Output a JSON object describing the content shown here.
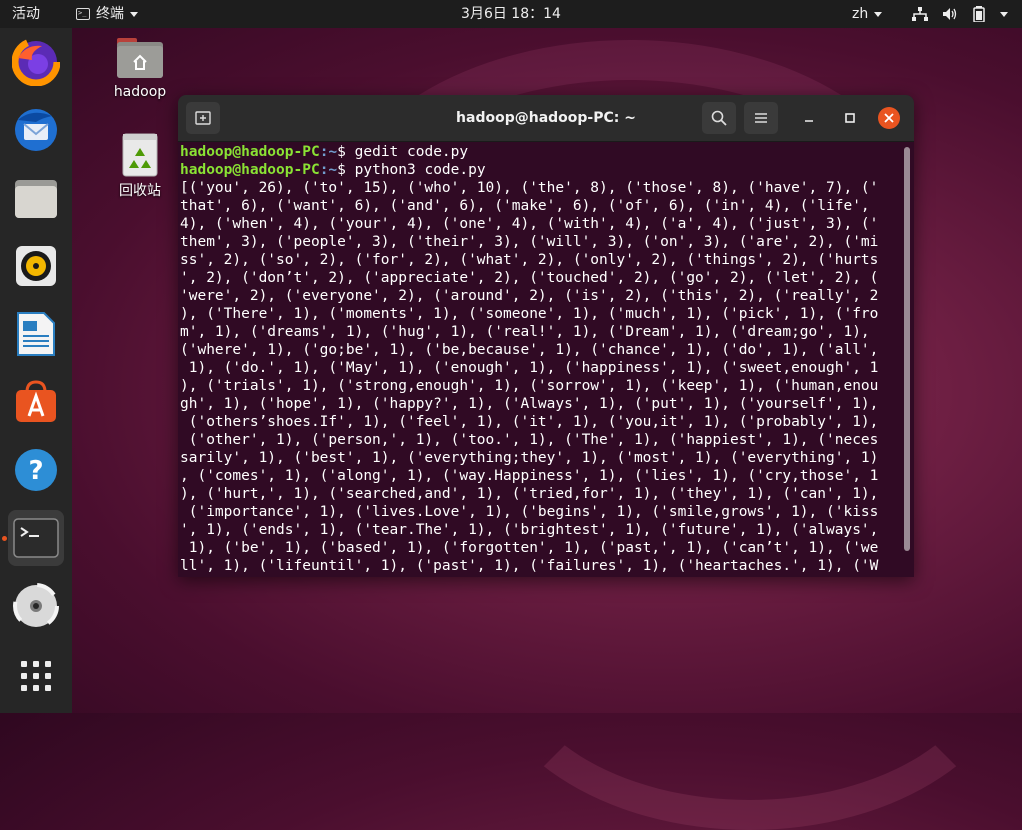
{
  "topbar": {
    "activities": "活动",
    "app_name": "终端",
    "clock": "3月6日  18：14",
    "lang": "zh"
  },
  "dock": {
    "items": [
      {
        "name": "firefox-icon",
        "running": false
      },
      {
        "name": "thunderbird-icon",
        "running": false
      },
      {
        "name": "files-icon",
        "running": false
      },
      {
        "name": "rhythmbox-icon",
        "running": false
      },
      {
        "name": "libreoffice-writer-icon",
        "running": false
      },
      {
        "name": "ubuntu-software-icon",
        "running": false
      },
      {
        "name": "help-icon",
        "running": false
      },
      {
        "name": "terminal-icon",
        "running": true
      },
      {
        "name": "dvd-icon",
        "running": false
      },
      {
        "name": "show-applications-icon",
        "running": false
      }
    ]
  },
  "desktop": {
    "home_label": "hadoop",
    "trash_label": "回收站"
  },
  "terminal": {
    "title": "hadoop@hadoop-PC: ~",
    "prompt_user": "hadoop@hadoop-PC",
    "prompt_path": ":~",
    "prompt_symbol": "$ ",
    "commands": [
      "gedit code.py",
      "python3 code.py"
    ],
    "output_lines": [
      "[('you', 26), ('to', 15), ('who', 10), ('the', 8), ('those', 8), ('have', 7), ('",
      "that', 6), ('want', 6), ('and', 6), ('make', 6), ('of', 6), ('in', 4), ('life',",
      "4), ('when', 4), ('your', 4), ('one', 4), ('with', 4), ('a', 4), ('just', 3), ('",
      "them', 3), ('people', 3), ('their', 3), ('will', 3), ('on', 3), ('are', 2), ('mi",
      "ss', 2), ('so', 2), ('for', 2), ('what', 2), ('only', 2), ('things', 2), ('hurts",
      "', 2), ('don’t', 2), ('appreciate', 2), ('touched', 2), ('go', 2), ('let', 2), (",
      "'were', 2), ('everyone', 2), ('around', 2), ('is', 2), ('this', 2), ('really', 2",
      "), ('There', 1), ('moments', 1), ('someone', 1), ('much', 1), ('pick', 1), ('fro",
      "m', 1), ('dreams', 1), ('hug', 1), ('real!', 1), ('Dream', 1), ('dream;go', 1),",
      "('where', 1), ('go;be', 1), ('be,because', 1), ('chance', 1), ('do', 1), ('all',",
      " 1), ('do.', 1), ('May', 1), ('enough', 1), ('happiness', 1), ('sweet,enough', 1",
      "), ('trials', 1), ('strong,enough', 1), ('sorrow', 1), ('keep', 1), ('human,enou",
      "gh', 1), ('hope', 1), ('happy?', 1), ('Always', 1), ('put', 1), ('yourself', 1),",
      " ('others’shoes.If', 1), ('feel', 1), ('it', 1), ('you,it', 1), ('probably', 1),",
      " ('other', 1), ('person,', 1), ('too.', 1), ('The', 1), ('happiest', 1), ('neces",
      "sarily', 1), ('best', 1), ('everything;they', 1), ('most', 1), ('everything', 1)",
      ", ('comes', 1), ('along', 1), ('way.Happiness', 1), ('lies', 1), ('cry,those', 1",
      "), ('hurt,', 1), ('searched,and', 1), ('tried,for', 1), ('they', 1), ('can', 1),",
      " ('importance', 1), ('lives.Love', 1), ('begins', 1), ('smile,grows', 1), ('kiss",
      "', 1), ('ends', 1), ('tear.The', 1), ('brightest', 1), ('future', 1), ('always',",
      " 1), ('be', 1), ('based', 1), ('forgotten', 1), ('past,', 1), ('can’t', 1), ('we",
      "ll', 1), ('lifeuntil', 1), ('past', 1), ('failures', 1), ('heartaches.', 1), ('W"
    ]
  },
  "colors": {
    "accent": "#e95420",
    "terminal_bg": "#300a24",
    "prompt_user": "#8ae234",
    "prompt_path": "#729fcf"
  }
}
